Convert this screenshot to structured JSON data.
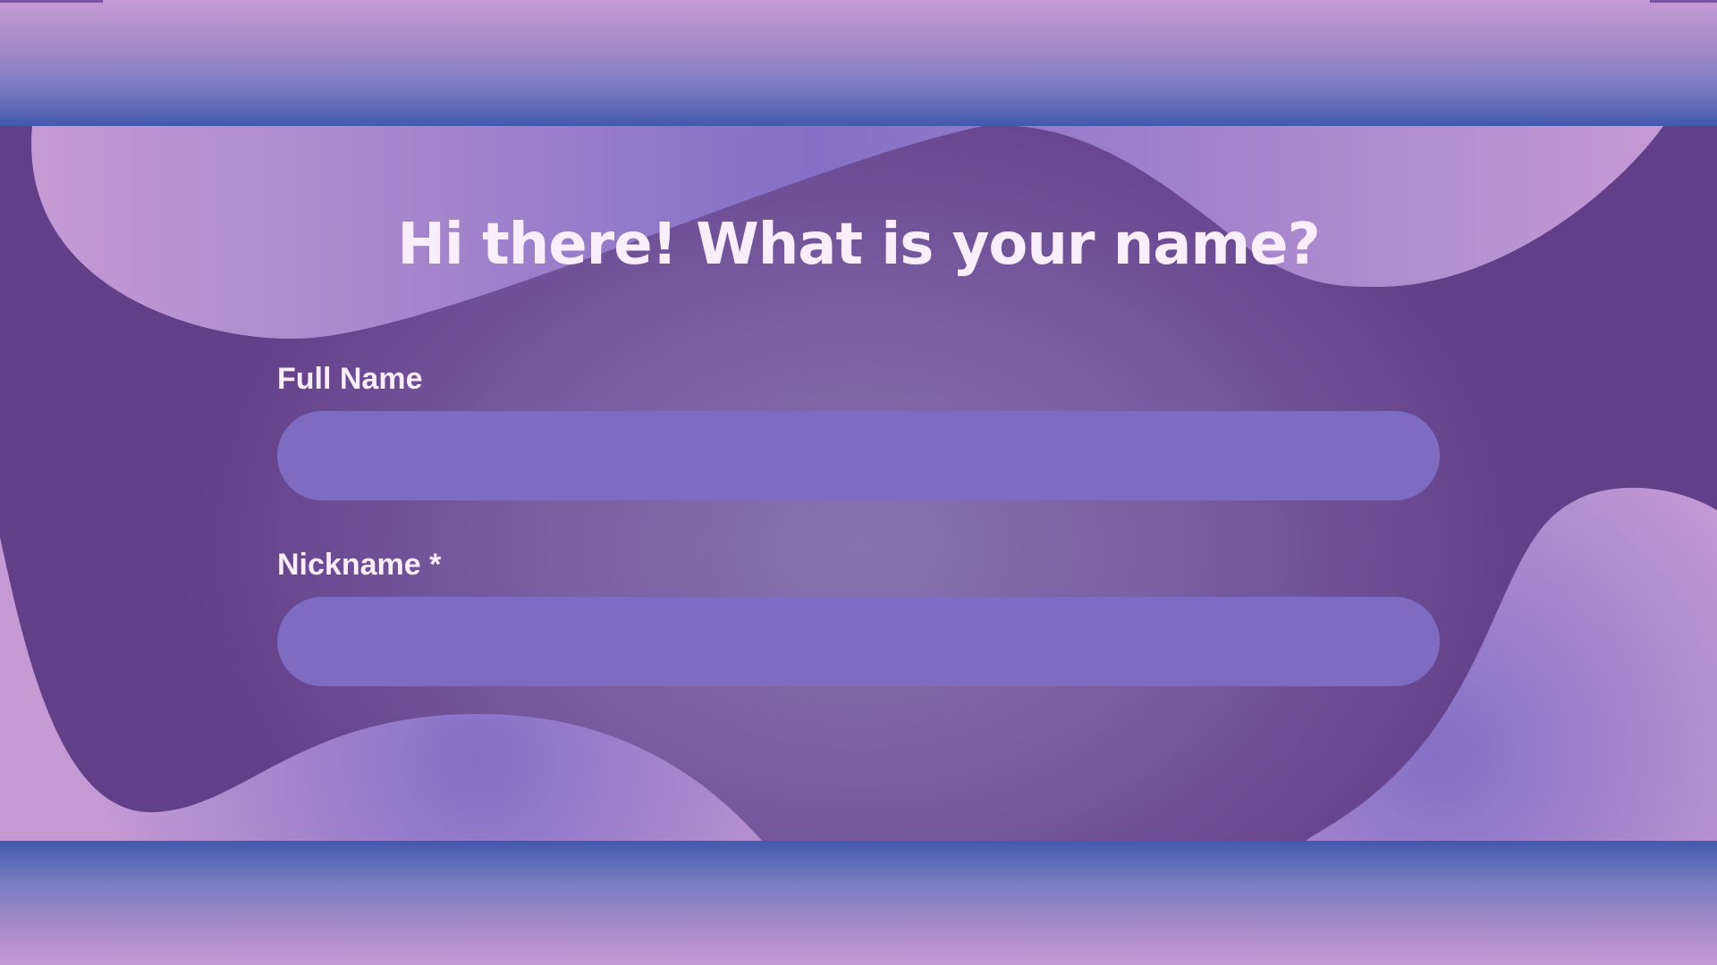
{
  "form": {
    "heading": "Hi there! What is your name?",
    "fields": [
      {
        "label": "Full Name",
        "value": "",
        "required": false
      },
      {
        "label": "Nickname *",
        "value": "",
        "required": true
      }
    ]
  },
  "colors": {
    "background": "#623f89",
    "input_fill": "#7e6bc2",
    "text": "#fbeefc",
    "band_blue": "#4259ab",
    "blob_pink": "#c59ad4"
  }
}
